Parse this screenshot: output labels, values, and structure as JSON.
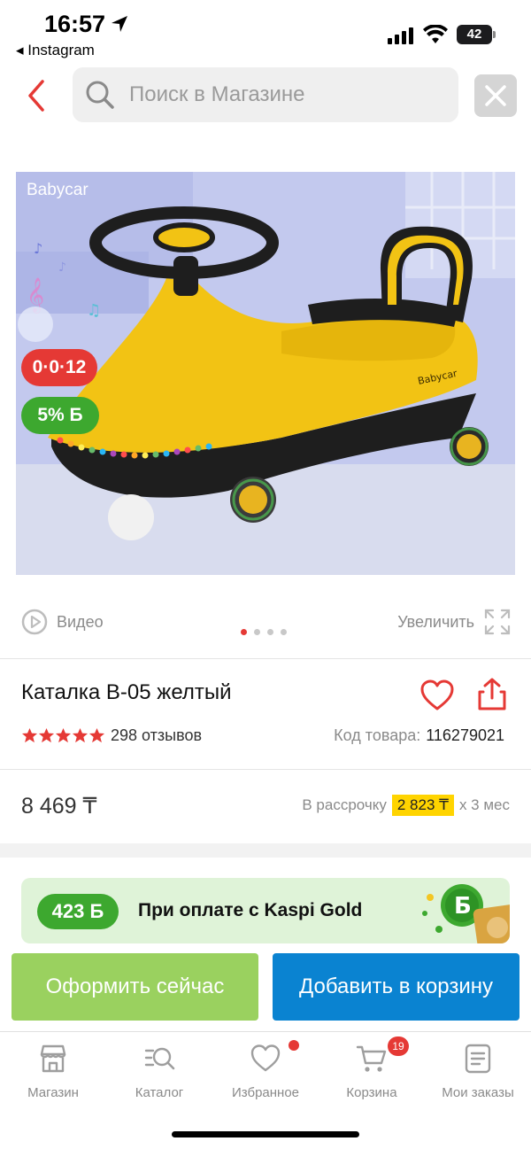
{
  "status_bar": {
    "time": "16:57",
    "back_app": "◂ Instagram",
    "battery": "42"
  },
  "search": {
    "placeholder": "Поиск в Магазине"
  },
  "product": {
    "brand_watermark": "Babycar",
    "timer_badge": "0·0·12",
    "bonus_badge": "5% Б",
    "title": "Каталка B-05 желтый",
    "rating_stars": 5,
    "reviews": "298 отзывов",
    "sku_label": "Код товара:",
    "sku_value": "116279021",
    "price": "8 469 ₸",
    "installment_prefix": "В рассрочку",
    "installment_amount": "2 823 ₸",
    "installment_suffix": "х 3 мес"
  },
  "media": {
    "video_label": "Видео",
    "zoom_label": "Увеличить",
    "image_count": 4,
    "active_image": 1
  },
  "gold_banner": {
    "bonus": "423 Б",
    "text": "При оплате с Kaspi Gold"
  },
  "actions": {
    "order_now": "Оформить сейчас",
    "add_to_cart": "Добавить в корзину"
  },
  "tabs": [
    {
      "label": "Магазин",
      "icon": "store-icon"
    },
    {
      "label": "Каталог",
      "icon": "catalog-search-icon"
    },
    {
      "label": "Избранное",
      "icon": "heart-icon"
    },
    {
      "label": "Корзина",
      "icon": "cart-icon"
    },
    {
      "label": "Мои заказы",
      "icon": "orders-icon"
    }
  ],
  "cart_count": "19",
  "colors": {
    "accent_red": "#e53935",
    "order_green": "#9ad15f",
    "cart_blue": "#0a83d1",
    "bonus_green": "#3da82f",
    "installment_yellow": "#ffd400"
  }
}
